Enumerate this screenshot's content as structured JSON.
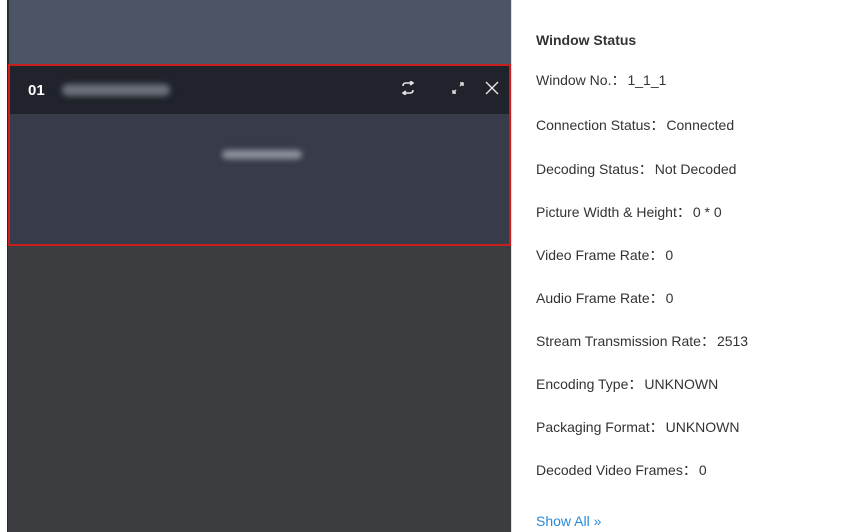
{
  "video_window": {
    "number": "01",
    "icons": [
      "refresh-icon",
      "expand-icon",
      "close-icon"
    ]
  },
  "status": {
    "title": "Window Status",
    "rows": [
      {
        "label": "Window No.",
        "sep": "：",
        "value": "1_1_1"
      },
      {
        "label": "Connection Status",
        "sep": "：",
        "value": "Connected"
      },
      {
        "label": "Decoding Status",
        "sep": "：",
        "value": "Not Decoded"
      },
      {
        "label": "Picture Width & Height",
        "sep": "：",
        "value": "0 * 0"
      },
      {
        "label": "Video Frame Rate",
        "sep": "：",
        "value": "0"
      },
      {
        "label": "Audio Frame Rate",
        "sep": "：",
        "value": "0"
      },
      {
        "label": "Stream Transmission Rate",
        "sep": "：",
        "value": "2513"
      },
      {
        "label": "Encoding Type",
        "sep": "：",
        "value": "UNKNOWN"
      },
      {
        "label": "Packaging Format",
        "sep": "：",
        "value": "UNKNOWN"
      },
      {
        "label": "Decoded Video Frames",
        "sep": "：",
        "value": "0"
      }
    ],
    "show_all": "Show All »"
  },
  "colors": {
    "selected_border": "#c81e1e",
    "link": "#2a8ad6",
    "header_bg": "#20232b",
    "body_bg": "#373b4a"
  }
}
